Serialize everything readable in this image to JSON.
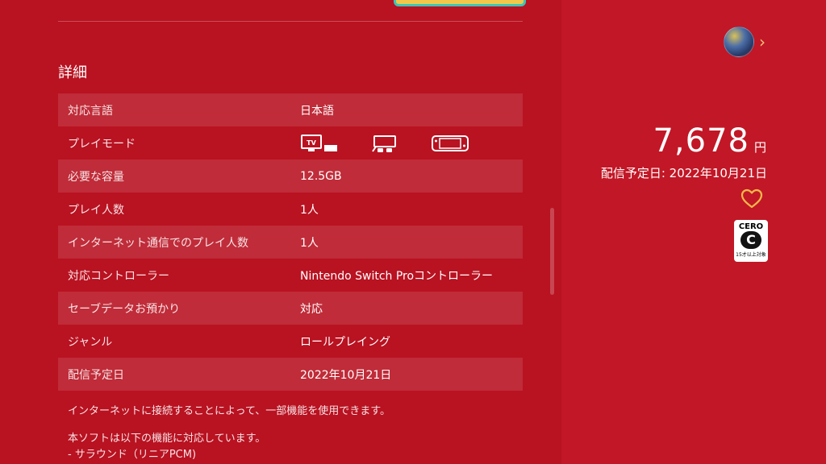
{
  "details": {
    "section_title": "詳細",
    "rows": [
      {
        "label": "対応言語",
        "value": "日本語"
      },
      {
        "label": "プレイモード",
        "modes": [
          "tv-mode-icon",
          "tabletop-mode-icon",
          "handheld-mode-icon"
        ]
      },
      {
        "label": "必要な容量",
        "value": "12.5GB"
      },
      {
        "label": "プレイ人数",
        "value": "1人"
      },
      {
        "label": "インターネット通信でのプレイ人数",
        "value": "1人"
      },
      {
        "label": "対応コントローラー",
        "value": "Nintendo Switch Proコントローラー"
      },
      {
        "label": "セーブデータお預かり",
        "value": "対応"
      },
      {
        "label": "ジャンル",
        "value": "ロールプレイング"
      },
      {
        "label": "配信予定日",
        "value": "2022年10月21日"
      }
    ],
    "notes": [
      "インターネットに接続することによって、一部機能を使用できます。",
      "本ソフトは以下の機能に対応しています。",
      "- サラウンド（リニアPCM)"
    ]
  },
  "sidebar": {
    "price": "7,678",
    "currency": "円",
    "release_text": "配信予定日: 2022年10月21日",
    "rating": {
      "org": "CERO",
      "letter": "C",
      "age_text": "15才以上対象"
    }
  },
  "colors": {
    "left_bg": "#b91221",
    "right_bg": "#c21726",
    "heart": "#f5b94a"
  }
}
